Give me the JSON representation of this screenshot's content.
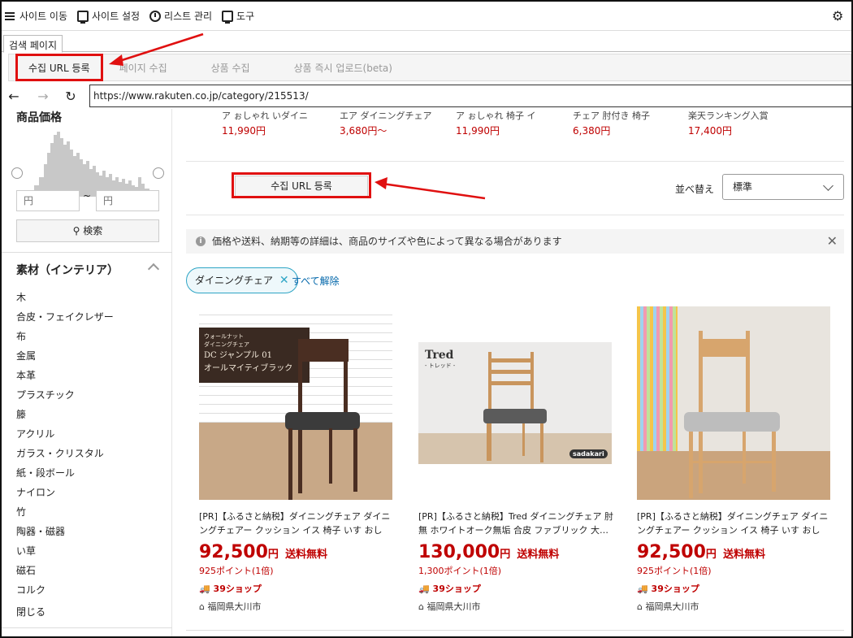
{
  "menubar": {
    "items": [
      {
        "label": "사이트 이동",
        "icon": "hamburger-icon"
      },
      {
        "label": "사이트 설정",
        "icon": "monitor-icon"
      },
      {
        "label": "리스트 관리",
        "icon": "clock-icon"
      },
      {
        "label": "도구",
        "icon": "monitor-icon"
      }
    ],
    "settings_icon": "gear-icon"
  },
  "tab": {
    "label": "검색 페이지"
  },
  "toolbar": {
    "collect_url": "수집 URL 등록",
    "page_collect": "페이지 수집",
    "product_collect": "상품 수집",
    "instant_upload": "상품 즉시 업로드(beta)"
  },
  "address": {
    "url": "https://www.rakuten.co.jp/category/215513/"
  },
  "sidebar": {
    "price_title": "商品価格",
    "min_placeholder": "円",
    "max_placeholder": "円",
    "tilde": "~",
    "search_label": "検索",
    "material_title": "素材（インテリア）",
    "materials": [
      "木",
      "合皮・フェイクレザー",
      "布",
      "金属",
      "本革",
      "プラスチック",
      "籐",
      "アクリル",
      "ガラス・クリスタル",
      "紙・段ボール",
      "ナイロン",
      "竹",
      "陶器・磁器",
      "い草",
      "磁石",
      "コルク"
    ],
    "close_label": "閉じる"
  },
  "top_products": [
    {
      "name": "ア ぉしゃれ いダイニ",
      "price": "11,990円"
    },
    {
      "name": "エア ダイニングチェア",
      "price": "3,680円〜"
    },
    {
      "name": "ア ぉしゃれ 椅子 イ",
      "price": "11,990円"
    },
    {
      "name": "チェア 肘付き 椅子",
      "price": "6,380円"
    },
    {
      "name": "楽天ランキング入賞",
      "price": "17,400円"
    }
  ],
  "main": {
    "collect_url": "수집 URL 등록",
    "sort_label": "並べ替え",
    "sort_value": "標準",
    "notice": "価格や送料、納期等の詳細は、商品のサイズや色によって異なる場合があります",
    "chip": "ダイニングチェア",
    "clear_all": "すべて解除"
  },
  "products": [
    {
      "name": "[PR]【ふるさと納税】ダイニングチェア ダイニングチェアー クッション イス 椅子 いす おしゃ…",
      "price": "92,500",
      "yen": "円",
      "shipping": "送料無料",
      "points": "925ポイント(1倍)",
      "shop": "39ショップ",
      "location": "福岡県大川市",
      "label_small1": "ウォールナット",
      "label_small2": "ダイニングチェア",
      "label_big1": "DC ジャンプル 01",
      "label_big2": "オールマイティブラック"
    },
    {
      "name": "[PR]【ふるさと納税】Tred ダイニングチェア 肘無 ホワイトオーク無垢 合皮 ファブリック 大…",
      "price": "130,000",
      "yen": "円",
      "shipping": "送料無料",
      "points": "1,300ポイント(1倍)",
      "shop": "39ショップ",
      "location": "福岡県大川市",
      "brand": "Tred",
      "brand_sub": "- トレッド -",
      "maker": "sadakari"
    },
    {
      "name": "[PR]【ふるさと納税】ダイニングチェア ダイニングチェアー クッション イス 椅子 いす おしゃ…",
      "price": "92,500",
      "yen": "円",
      "shipping": "送料無料",
      "points": "925ポイント(1倍)",
      "shop": "39ショップ",
      "location": "福岡県大川市"
    }
  ],
  "colors": {
    "highlight": "#e01010",
    "price_red": "#bf0000",
    "chip_border": "#2ea5c5"
  }
}
